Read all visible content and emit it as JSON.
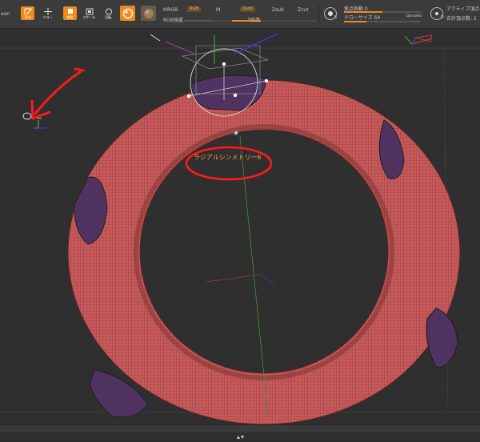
{
  "toolbar": {
    "cut_label": "ean",
    "tools": {
      "edit": "Edit",
      "draw": "ドロー",
      "move": "移動",
      "scale": "スケール",
      "rotate": "回転"
    },
    "mrgb": "MRGB",
    "rgb": "RGB",
    "m": "M",
    "rgb_intensity": "RGB強度",
    "zadd": "Zadd",
    "zsub": "Zsub",
    "zcut": "Zcut",
    "z_intensity": "Z強度",
    "focal_shift_label": "焦点移動 0",
    "focal_shift_value": 0,
    "draw_size_label": "ドローサイズ 64",
    "draw_size_value": 64,
    "dynamic": "Dynamic",
    "active_points_label": "アクティブ頂点",
    "total_points_label": "合計頂点数: 2",
    "icon_s": "S",
    "icon_d": "D"
  },
  "viewport": {
    "annotation_text": "ラジアルシンメトリー6"
  },
  "colors": {
    "accent": "#f08a1c",
    "torus": "#c85a5a",
    "masked": "#5a3a6e",
    "annotation": "#ff1a1a"
  },
  "icons": [
    "edit-icon",
    "draw-icon",
    "move-icon",
    "scale-icon",
    "rotate-icon",
    "sphere-icon",
    "material-icon",
    "dot-s-icon",
    "dot-d-icon",
    "gizmo-icon"
  ]
}
